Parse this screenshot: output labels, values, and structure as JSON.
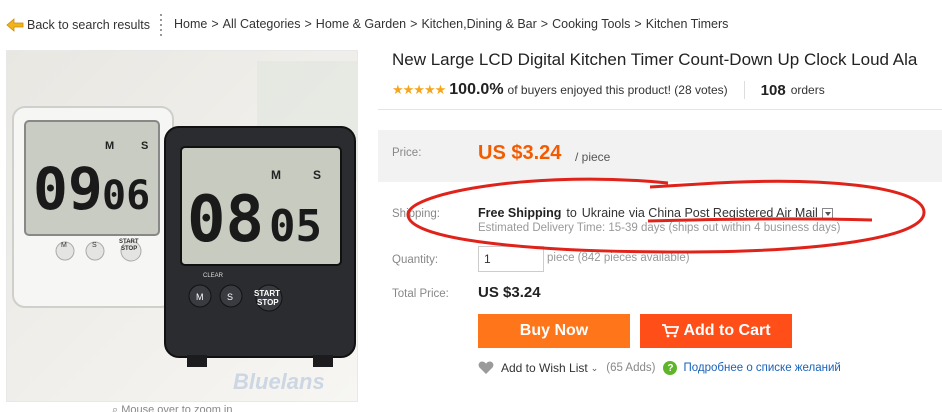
{
  "breadcrumb": {
    "back_label": "Back to search results",
    "items": [
      "Home",
      "All Categories",
      "Home & Garden",
      "Kitchen,Dining & Bar",
      "Cooking Tools",
      "Kitchen Timers"
    ]
  },
  "product": {
    "title": "New Large LCD Digital Kitchen Timer Count-Down Up Clock Loud Ala",
    "stars": "★★★★★",
    "rating_percent": "100.0%",
    "rating_text": "of buyers enjoyed this product! (28 votes)",
    "orders_count": "108",
    "orders_label": "orders",
    "image": {
      "timer_left_digits": "0906",
      "timer_right_digits": "0805",
      "watermark": "Bluelans",
      "btn_m": "M",
      "btn_s": "S",
      "btn_start_stop": "START STOP",
      "clear_label": "CLEAR"
    },
    "zoom_hint": "Mouse over to zoom in"
  },
  "price": {
    "label": "Price:",
    "value": "US $3.24",
    "unit": "/ piece"
  },
  "shipping": {
    "label": "Shipping:",
    "free": "Free Shipping",
    "to": "to",
    "country": "Ukraine",
    "via": "via China Post Registered Air Mail",
    "estimated": "Estimated Delivery Time: 15-39 days (ships out within 4 business days)"
  },
  "quantity": {
    "label": "Quantity:",
    "value": "1",
    "info": "piece (842 pieces available)"
  },
  "total": {
    "label": "Total Price:",
    "value": "US $3.24"
  },
  "actions": {
    "buy_now": "Buy Now",
    "add_to_cart": "Add to Cart",
    "wish_list": "Add to Wish List",
    "wish_adds": "(65 Adds)",
    "more_link": "Подробнее о списке желаний"
  },
  "colors": {
    "price": "#f35b00",
    "buy_now": "#ff7519",
    "add_to_cart": "#ff4e18",
    "annotation": "#e0231a",
    "link": "#1a62b8"
  }
}
